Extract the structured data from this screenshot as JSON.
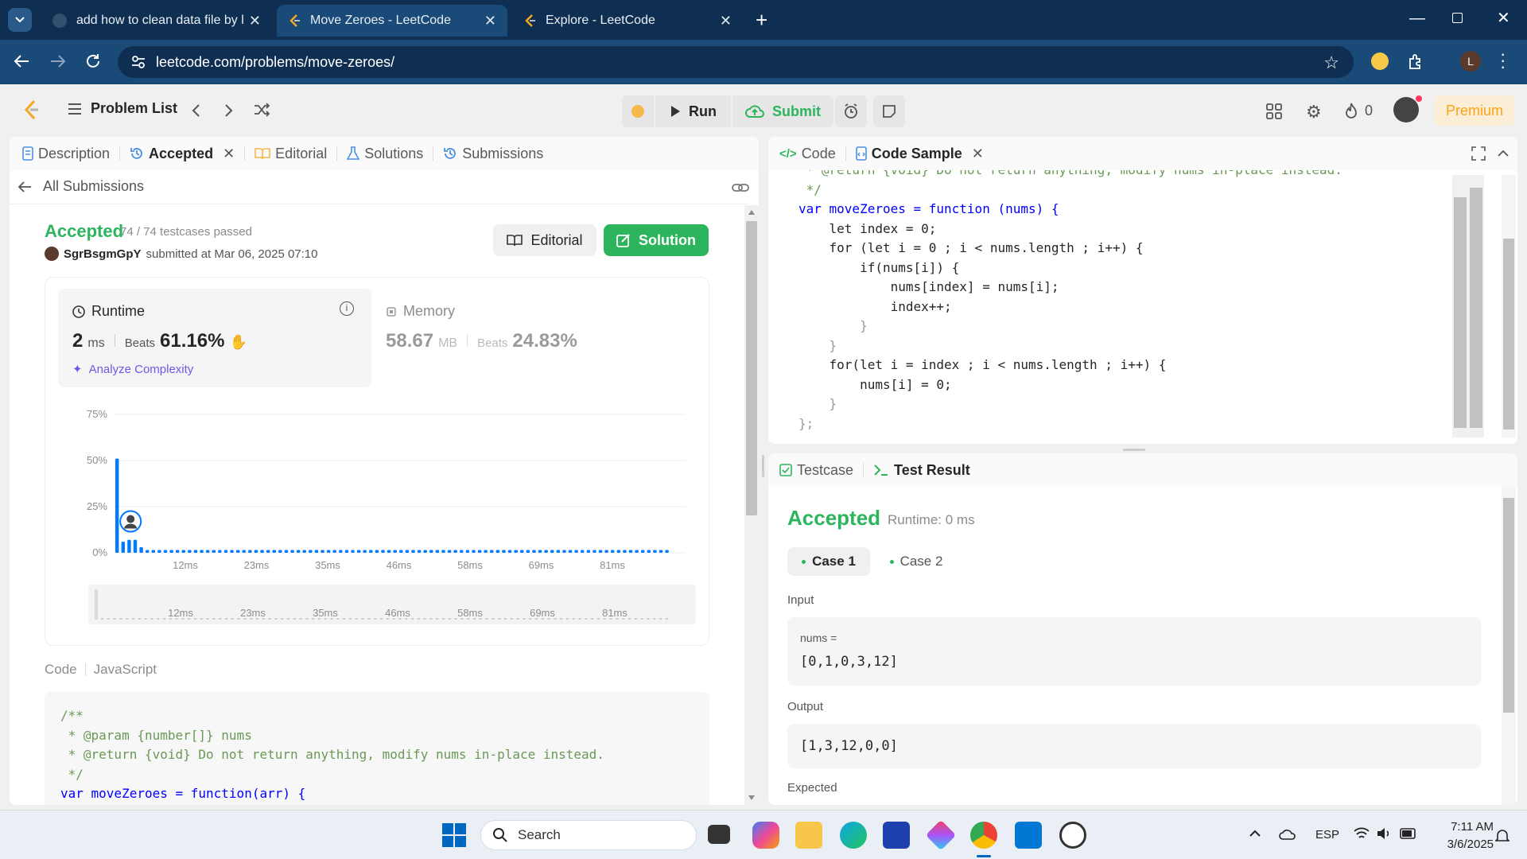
{
  "browser": {
    "tabs": [
      {
        "title": "add how to clean data file by lu"
      },
      {
        "title": "Move Zeroes - LeetCode"
      },
      {
        "title": "Explore - LeetCode"
      }
    ],
    "url": "leetcode.com/problems/move-zeroes/",
    "profile_initial": "L"
  },
  "topnav": {
    "problem_list": "Problem List",
    "run": "Run",
    "submit": "Submit",
    "streak": "0",
    "premium": "Premium"
  },
  "left_tabs": {
    "description": "Description",
    "accepted": "Accepted",
    "editorial": "Editorial",
    "solutions": "Solutions",
    "submissions": "Submissions"
  },
  "submission": {
    "back": "All Submissions",
    "status": "Accepted",
    "testcases": "74 / 74 testcases passed",
    "user": "SgrBsgmGpY",
    "submitted_at": "submitted at Mar 06, 2025 07:10",
    "editorial_btn": "Editorial",
    "solution_btn": "Solution",
    "runtime_label": "Runtime",
    "runtime_value": "2",
    "runtime_unit": "ms",
    "beats_label": "Beats",
    "runtime_beats": "61.16%",
    "analyze": "Analyze Complexity",
    "memory_label": "Memory",
    "memory_value": "58.67",
    "memory_unit": "MB",
    "memory_beats": "24.83%",
    "code_label": "Code",
    "lang_label": "JavaScript"
  },
  "chart_data": {
    "type": "bar",
    "y_ticks": [
      "75%",
      "50%",
      "25%",
      "0%"
    ],
    "ylim": [
      0,
      75
    ],
    "x_ticks": [
      "12ms",
      "23ms",
      "35ms",
      "46ms",
      "58ms",
      "69ms",
      "81ms"
    ],
    "values": [
      51,
      6,
      7,
      7,
      3,
      1.5,
      1.5,
      1.5,
      1.5,
      1.5,
      1.5,
      1.5,
      1.5,
      1.5,
      1.5,
      1.5,
      1.5,
      1.5,
      1.5,
      1.5,
      1.5,
      1.5,
      1.5,
      1.5,
      1.5,
      1.5,
      1.5,
      1.5,
      1.5,
      1.5,
      1.5,
      1.5,
      1.5,
      1.5,
      1.5,
      1.5,
      1.5,
      1.5,
      1.5,
      1.5,
      1.5,
      1.5,
      1.5,
      1.5,
      1.5,
      1.5,
      1.5,
      1.5,
      1.5,
      1.5,
      1.5,
      1.5,
      1.5,
      1.5,
      1.5,
      1.5,
      1.5,
      1.5,
      1.5,
      1.5,
      1.5,
      1.5,
      1.5,
      1.5,
      1.5,
      1.5,
      1.5,
      1.5,
      1.5,
      1.5,
      1.5,
      1.5,
      1.5,
      1.5,
      1.5,
      1.5,
      1.5,
      1.5,
      1.5,
      1.5,
      1.5,
      1.5,
      1.5,
      1.5,
      1.5,
      1.5,
      1.5,
      1.5,
      1.5,
      1.5,
      1.5,
      1.5
    ],
    "color": "#007aff",
    "user_bar_index": 2,
    "brush_ticks": [
      "12ms",
      "23ms",
      "35ms",
      "46ms",
      "58ms",
      "69ms",
      "81ms"
    ]
  },
  "submitted_code": [
    "/**",
    " * @param {number[]} nums",
    " * @return {void} Do not return anything, modify nums in-place instead.",
    " */",
    "var moveZeroes = function(arr) {"
  ],
  "right_tabs": {
    "code": "Code",
    "code_sample": "Code Sample"
  },
  "editor_lines": [
    " * @return {void} Do not return anything, modify nums in-place instead.",
    " */",
    "var moveZeroes = function (nums) {",
    "    let index = 0;",
    "    for (let i = 0 ; i < nums.length ; i++) {",
    "        if(nums[i]) {",
    "            nums[index] = nums[i];",
    "            index++;",
    "        }",
    "    }",
    "    for(let i = index ; i < nums.length ; i++) {",
    "        nums[i] = 0;",
    "    }",
    "};"
  ],
  "test": {
    "testcase_tab": "Testcase",
    "result_tab": "Test Result",
    "status": "Accepted",
    "runtime": "Runtime: 0 ms",
    "case1": "Case 1",
    "case2": "Case 2",
    "input_label": "Input",
    "var_name": "nums =",
    "input_value": "[0,1,0,3,12]",
    "output_label": "Output",
    "output_value": "[1,3,12,0,0]",
    "expected_label": "Expected"
  },
  "taskbar": {
    "search": "Search",
    "lang": "ESP",
    "time": "7:11 AM",
    "date": "3/6/2025"
  },
  "colors": {
    "accent_green": "#2db55d",
    "premium": "#ffa116",
    "chart_blue": "#007aff",
    "chrome_dark": "#0f2f52",
    "chrome_mid": "#1a4a78"
  }
}
